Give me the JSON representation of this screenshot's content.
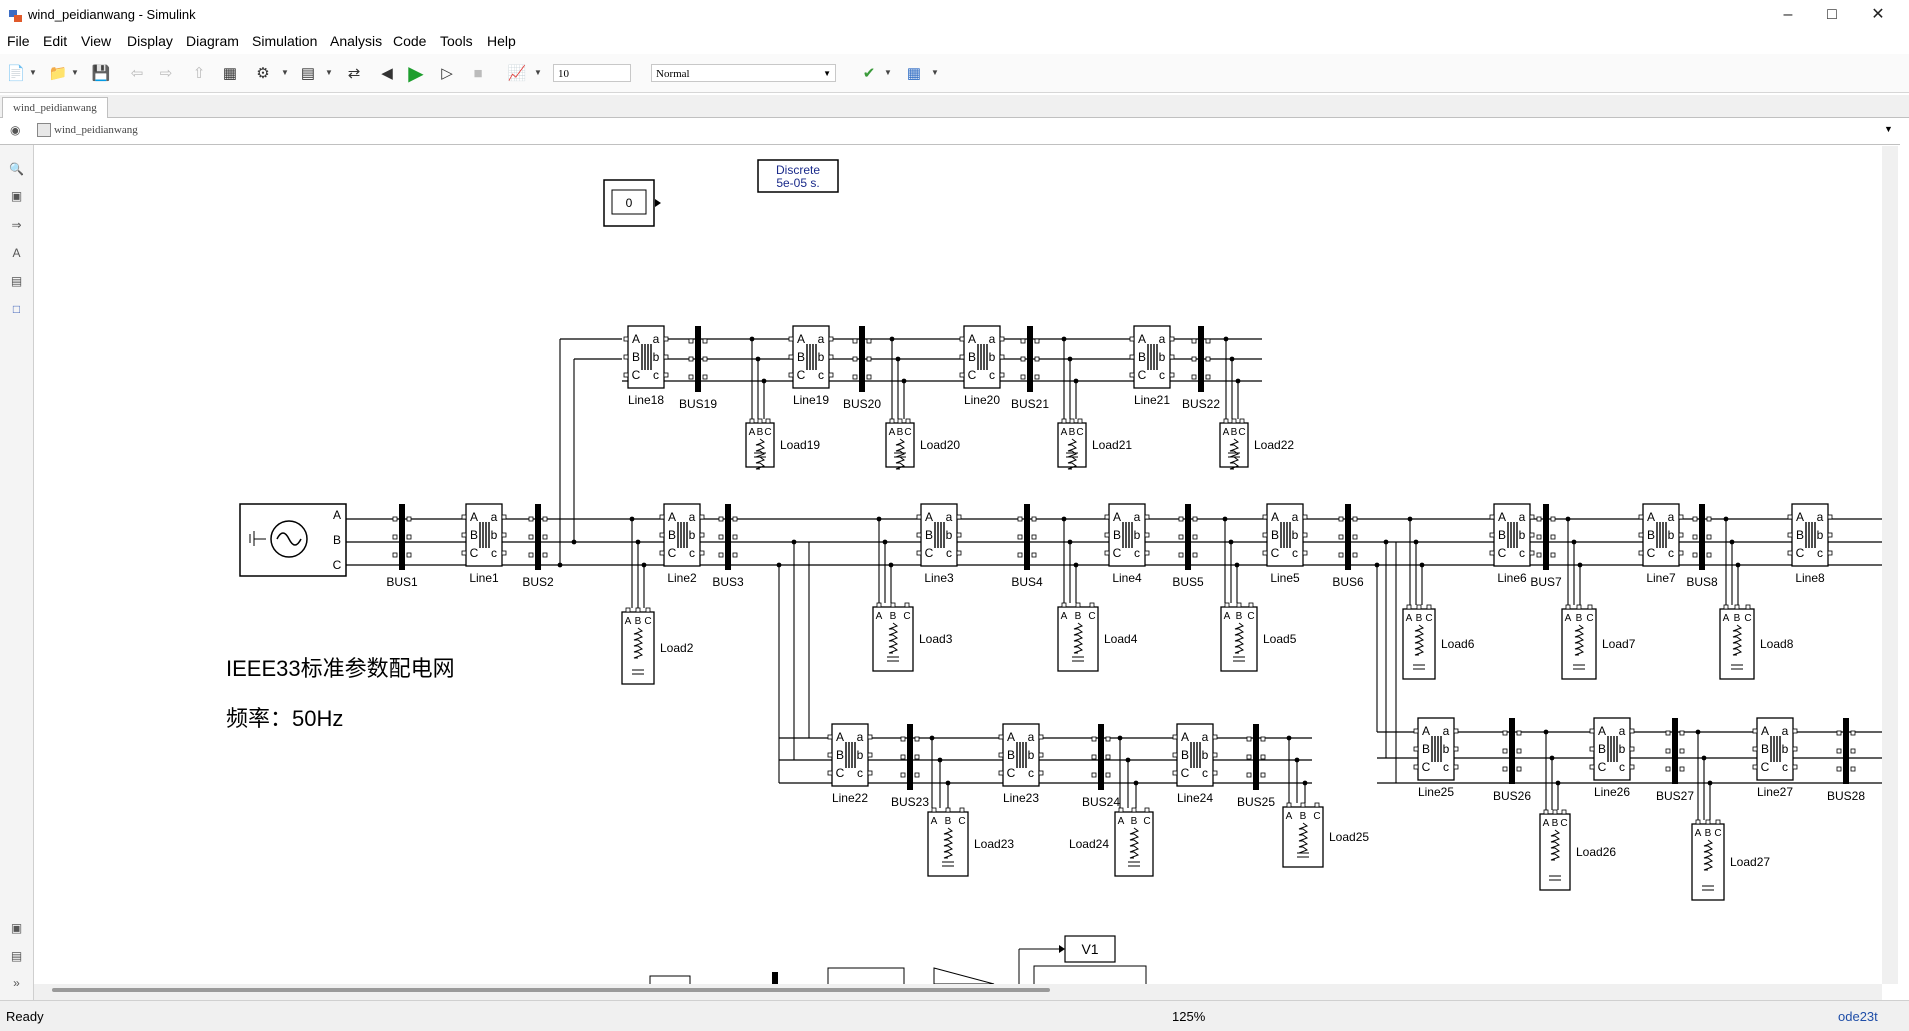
{
  "window": {
    "title": "wind_peidianwang - Simulink"
  },
  "menu": [
    "File",
    "Edit",
    "View",
    "Display",
    "Diagram",
    "Simulation",
    "Analysis",
    "Code",
    "Tools",
    "Help"
  ],
  "toolbar": {
    "stop_time": "10",
    "sim_mode": "Normal"
  },
  "tabs": [
    "wind_peidianwang"
  ],
  "breadcrumb": "wind_peidianwang",
  "diagram": {
    "powergui": [
      "Discrete",
      "5e-05 s."
    ],
    "display_value": "0",
    "annotation": [
      "IEEE33标准参数配电网",
      "频率：50Hz"
    ],
    "scope_label": "V1",
    "source_ports": [
      "A",
      "B",
      "C"
    ],
    "line_ports_left": [
      "A",
      "B",
      "C"
    ],
    "line_ports_right": [
      "a",
      "b",
      "c"
    ],
    "load_ports": [
      "A",
      "B",
      "C"
    ],
    "main_row": [
      {
        "type": "bus",
        "label": "BUS1"
      },
      {
        "type": "line",
        "label": "Line1"
      },
      {
        "type": "bus",
        "label": "BUS2"
      },
      {
        "type": "line",
        "label": "Line2"
      },
      {
        "type": "bus",
        "label": "BUS3"
      },
      {
        "type": "line",
        "label": "Line3"
      },
      {
        "type": "bus",
        "label": "BUS4"
      },
      {
        "type": "line",
        "label": "Line4"
      },
      {
        "type": "bus",
        "label": "BUS5"
      },
      {
        "type": "line",
        "label": "Line5"
      },
      {
        "type": "bus",
        "label": "BUS6"
      },
      {
        "type": "line",
        "label": "Line6"
      },
      {
        "type": "bus",
        "label": "BUS7"
      },
      {
        "type": "line",
        "label": "Line7"
      },
      {
        "type": "bus",
        "label": "BUS8"
      },
      {
        "type": "line",
        "label": "Line8"
      }
    ],
    "main_loads": [
      "Load2",
      "Load3",
      "Load4",
      "Load5",
      "Load6",
      "Load7",
      "Load8"
    ],
    "top_row": [
      {
        "type": "line",
        "label": "Line18"
      },
      {
        "type": "bus",
        "label": "BUS19"
      },
      {
        "type": "line",
        "label": "Line19"
      },
      {
        "type": "bus",
        "label": "BUS20"
      },
      {
        "type": "line",
        "label": "Line20"
      },
      {
        "type": "bus",
        "label": "BUS21"
      },
      {
        "type": "line",
        "label": "Line21"
      },
      {
        "type": "bus",
        "label": "BUS22"
      }
    ],
    "top_loads": [
      "Load19",
      "Load20",
      "Load21",
      "Load22"
    ],
    "lower_left_row": [
      {
        "type": "line",
        "label": "Line22"
      },
      {
        "type": "bus",
        "label": "BUS23"
      },
      {
        "type": "line",
        "label": "Line23"
      },
      {
        "type": "bus",
        "label": "BUS24"
      },
      {
        "type": "line",
        "label": "Line24"
      },
      {
        "type": "bus",
        "label": "BUS25"
      }
    ],
    "lower_left_loads": [
      "Load23",
      "Load24",
      "Load25"
    ],
    "lower_right_row": [
      {
        "type": "line",
        "label": "Line25"
      },
      {
        "type": "bus",
        "label": "BUS26"
      },
      {
        "type": "line",
        "label": "Line26"
      },
      {
        "type": "bus",
        "label": "BUS27"
      },
      {
        "type": "line",
        "label": "Line27"
      },
      {
        "type": "bus",
        "label": "BUS28"
      }
    ],
    "lower_right_loads": [
      "Load26",
      "Load27"
    ]
  },
  "status": {
    "state": "Ready",
    "zoom": "125%",
    "solver": "ode23t"
  }
}
